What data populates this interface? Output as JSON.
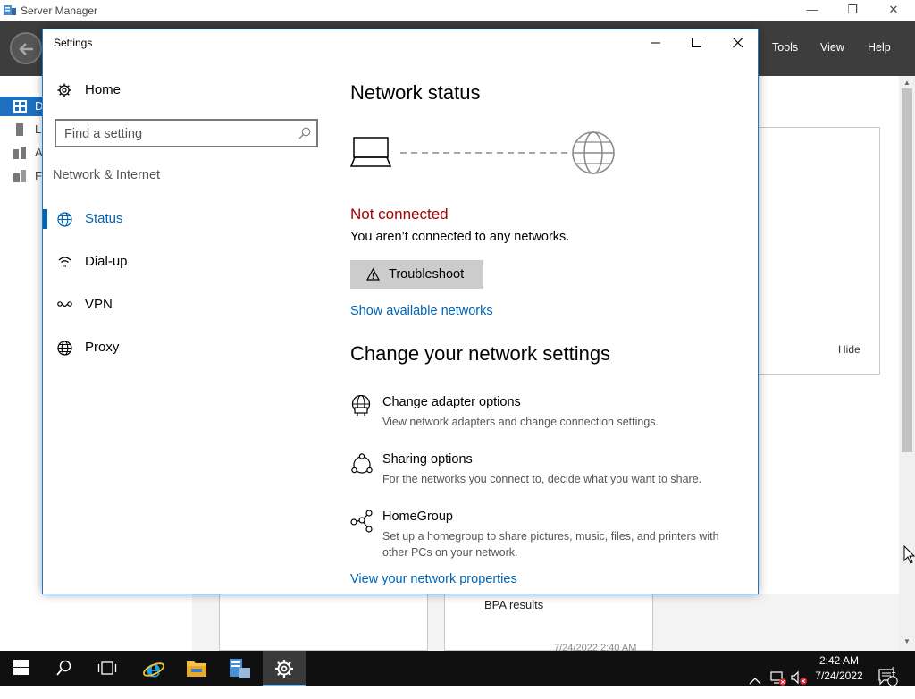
{
  "server_manager": {
    "title": "Server Manager",
    "menu": [
      "Tools",
      "View",
      "Help"
    ],
    "sidebar_letters": [
      "D",
      "L",
      "A",
      "F"
    ],
    "hide_label": "Hide",
    "bpa_label": "BPA results",
    "tile_date": "7/24/2022 2:40 AM"
  },
  "settings": {
    "window_title": "Settings",
    "home_label": "Home",
    "search_placeholder": "Find a setting",
    "section_label": "Network & Internet",
    "nav": [
      {
        "label": "Status",
        "icon": "globe-icon",
        "active": true
      },
      {
        "label": "Dial-up",
        "icon": "dialup-icon",
        "active": false
      },
      {
        "label": "VPN",
        "icon": "vpn-icon",
        "active": false
      },
      {
        "label": "Proxy",
        "icon": "globe-icon",
        "active": false
      }
    ],
    "main": {
      "network_status_heading": "Network status",
      "status_title": "Not connected",
      "status_desc": "You aren’t connected to any networks.",
      "troubleshoot_label": "Troubleshoot",
      "show_networks_link": "Show available networks",
      "change_heading": "Change your network settings",
      "options": [
        {
          "title": "Change adapter options",
          "desc": "View network adapters and change connection settings.",
          "icon": "adapter-icon"
        },
        {
          "title": "Sharing options",
          "desc": "For the networks you connect to, decide what you want to share.",
          "icon": "sharing-icon"
        },
        {
          "title": "HomeGroup",
          "desc": "Set up a homegroup to share pictures, music, files, and printers with other PCs on your network.",
          "icon": "homegroup-icon"
        }
      ],
      "properties_link": "View your network properties"
    }
  },
  "taskbar": {
    "time": "2:42 AM",
    "date": "7/24/2022",
    "notification_count": "1",
    "accent": "#76b9ed"
  },
  "colors": {
    "link": "#0063b1",
    "error": "#a80000",
    "taskbar": "#101010"
  }
}
